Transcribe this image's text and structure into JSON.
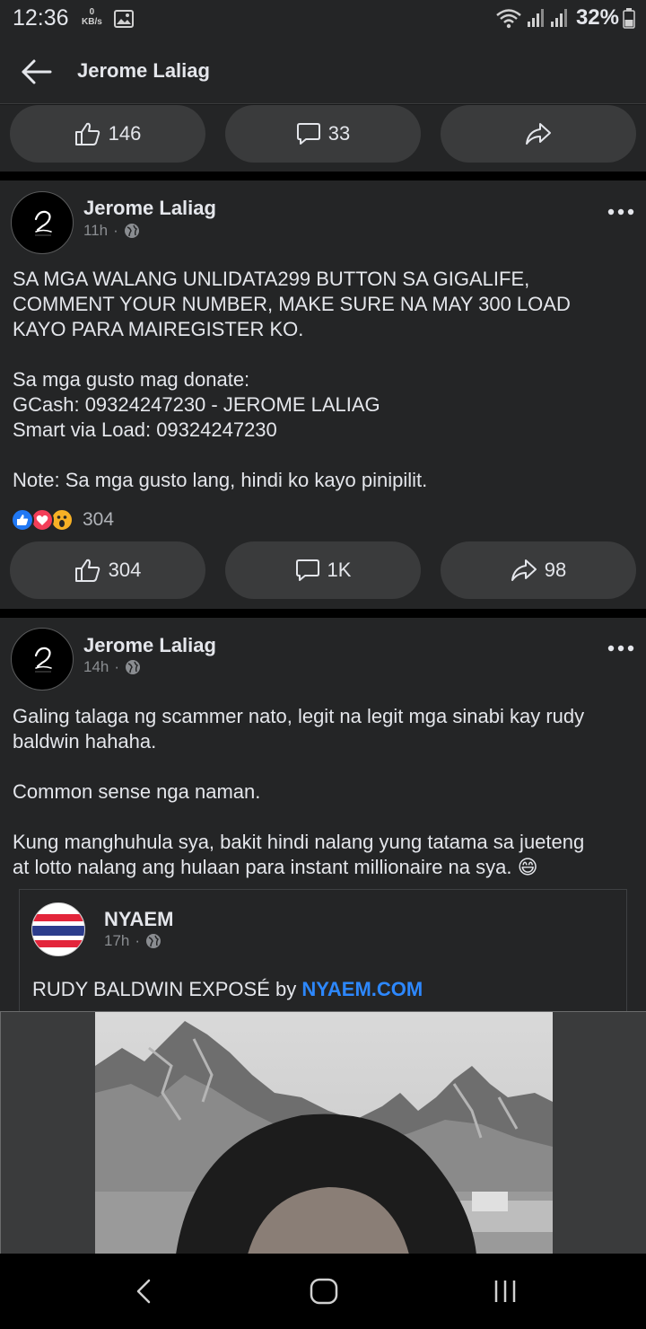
{
  "status_bar": {
    "time": "12:36",
    "net_speed_value": "0",
    "net_speed_unit": "KB/s",
    "battery": "32%"
  },
  "app_bar": {
    "title": "Jerome Laliag"
  },
  "top_actions": {
    "like_count": "146",
    "comment_count": "33"
  },
  "post1": {
    "author": "Jerome Laliag",
    "time": "11h",
    "separator": "·",
    "lines": [
      "SA MGA WALANG UNLIDATA299 BUTTON SA GIGALIFE,",
      "COMMENT YOUR NUMBER, MAKE SURE NA MAY 300 LOAD",
      "KAYO PARA MAIREGISTER KO.",
      "",
      "Sa mga gusto mag donate:",
      "GCash: 09324247230 - JEROME LALIAG",
      "Smart via Load: 09324247230",
      "",
      "Note: Sa mga gusto lang, hindi ko kayo pinipilit."
    ],
    "reaction_total": "304",
    "like_count": "304",
    "comment_count": "1K",
    "share_count": "98"
  },
  "post2": {
    "author": "Jerome Laliag",
    "time": "14h",
    "separator": "·",
    "lines": [
      "Galing talaga ng scammer nato, legit na legit mga sinabi kay rudy",
      "baldwin hahaha.",
      "",
      "Common sense nga naman.",
      "",
      "Kung manghuhula sya, bakit hindi nalang yung tatama sa jueteng",
      "at lotto nalang ang hulaan para instant millionaire na sya. 😄"
    ],
    "shared": {
      "author": "NYAEM",
      "time": "17h",
      "separator": "·",
      "text": "RUDY BALDWIN EXPOSÉ by",
      "link": "NYAEM.COM"
    }
  },
  "colors": {
    "background": "#18191a",
    "card": "#242526",
    "pill": "#3a3b3c",
    "text": "#e4e6eb",
    "secondary_text": "#8a8d91",
    "link": "#2d88ff",
    "like_blue": "#2078f4",
    "love_red": "#f33e58",
    "wow_yellow": "#f7b125"
  }
}
